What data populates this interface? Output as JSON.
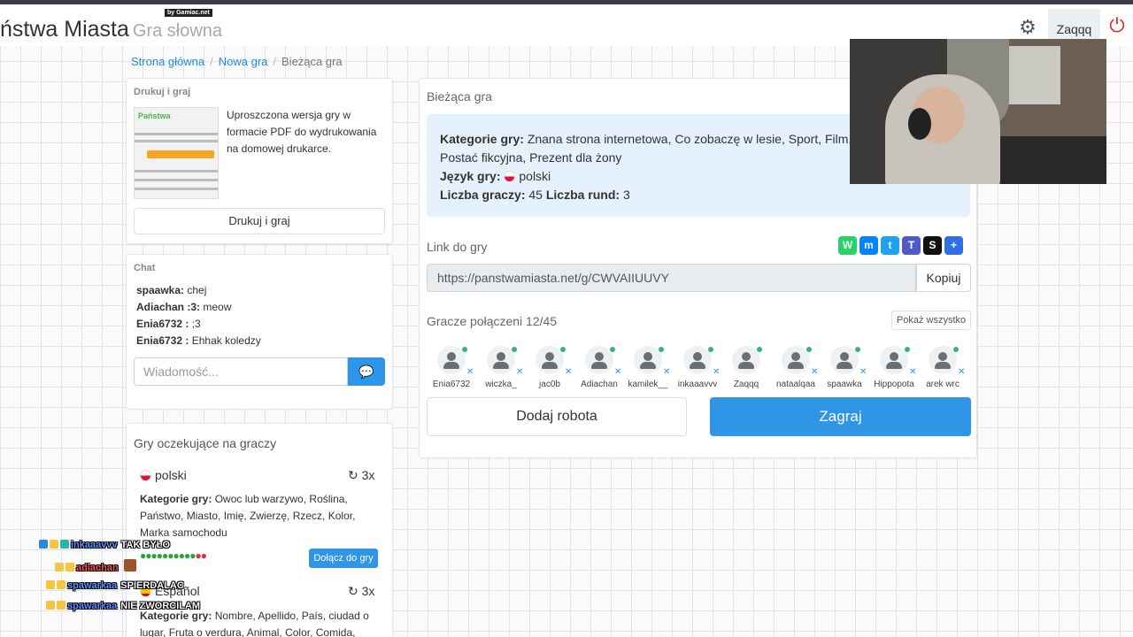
{
  "header": {
    "brand": "ństwa Miasta",
    "brand_sub": "Gra słowna",
    "by_badge": "by Gamiac.net",
    "gear_icon": "gear-icon",
    "username": "Zaqqq",
    "power_icon": "power-icon"
  },
  "breadcrumb": {
    "home": "Strona główna",
    "new_game": "Nowa gra",
    "current": "Bieżąca gra"
  },
  "print_card": {
    "title": "Drukuj i graj",
    "thumb_logo": "Państwa",
    "description": "Uproszczona wersja gry w formacie PDF do wydrukowania na domowej drukarce.",
    "button": "Drukuj i graj"
  },
  "chat": {
    "title": "Chat",
    "messages": [
      {
        "user": "spaawka:",
        "text": "chej"
      },
      {
        "user": "Adiachan :3:",
        "text": "meow"
      },
      {
        "user": "Enia6732 :",
        "text": ";3"
      },
      {
        "user": "Enia6732 :",
        "text": "Ehhak koledzy"
      }
    ],
    "placeholder": "Wiadomość...",
    "send_icon": "chat-bubble-icon"
  },
  "waiting_games": {
    "title": "Gry oczekujące na graczy",
    "games": [
      {
        "language": "polski",
        "rounds": "3x",
        "categories_label": "Kategorie gry:",
        "categories": "Owoc lub warzywo, Roślina, Państwo, Miasto, Imię, Zwierzę, Rzecz, Kolor, Marka samochodu",
        "players_green": "●●●●●●●●●●",
        "players_red": "●●",
        "join_button": "Dołącz do gry"
      },
      {
        "language": "Español",
        "rounds": "3x",
        "categories_label": "Kategorie gry:",
        "categories": "Nombre, Apellido, País, ciudad o lugar, Fruta o verdura, Animal, Color, Comida,"
      }
    ]
  },
  "current_game": {
    "title": "Bieżąca gra",
    "categories_label": "Kategorie gry:",
    "categories": "Znana strona internetowa, Co zobaczę w lesie, Sport, Film, Postać fikcyjna, Prezent dla żony",
    "language_label": "Język gry:",
    "language": "polski",
    "players_count_label": "Liczba graczy:",
    "players_count": "45",
    "rounds_label": "Liczba rund:",
    "rounds": "3",
    "link_label": "Link do gry",
    "link": "https://panstwamiasta.net/g/CWVAIIUUVY",
    "copy_button": "Kopiuj",
    "share_icons": [
      "whatsapp-icon",
      "messenger-icon",
      "twitter-icon",
      "teams-icon",
      "snapchat-icon",
      "share-plus-icon"
    ],
    "share_colors": [
      "#25d366",
      "#0084ff",
      "#1da1f2",
      "#5059c9",
      "#111111",
      "#2f6fe6"
    ],
    "connected_label": "Gracze połączeni 12/45",
    "show_all": "Pokaż wszystko",
    "players": [
      "Enia6732",
      "wiczka_",
      "jac0b",
      "Adiachan",
      "kamilek__",
      "inkaaavvv",
      "Zaqqq",
      "nataalqaa",
      "spaawka",
      "Hippopota",
      "arek wrc"
    ],
    "add_robot": "Dodaj robota",
    "play": "Zagraj"
  },
  "stream_overlay": [
    {
      "user": "inkaaavvv",
      "msg": "TAK BYŁO"
    },
    {
      "user": "adiachan",
      "msg": ""
    },
    {
      "user": "spawarkaa",
      "msg": "SPIERDALAC"
    },
    {
      "user": "spawarkaa",
      "msg": "NIE ZWORCILAM"
    }
  ]
}
